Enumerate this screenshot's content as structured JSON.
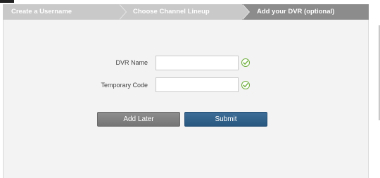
{
  "wizard": {
    "steps": [
      {
        "label": "Create a Username"
      },
      {
        "label": "Choose Channel Lineup"
      },
      {
        "label": "Add your DVR (optional)"
      }
    ]
  },
  "form": {
    "dvr_name_label": "DVR Name",
    "dvr_name_value": "",
    "temporary_code_label": "Temporary Code",
    "temporary_code_value": ""
  },
  "buttons": {
    "add_later": "Add Later",
    "submit": "Submit"
  },
  "colors": {
    "active_step": "#8c8c8c",
    "inactive_step": "#c9c9c9",
    "submit": "#2f5f88",
    "add_later": "#7e7e7e",
    "valid_check": "#6eae3c"
  },
  "icons": {
    "valid": "check-circle-icon"
  }
}
